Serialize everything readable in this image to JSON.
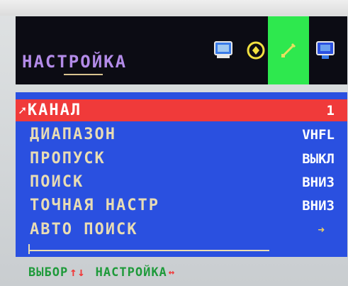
{
  "menu": {
    "title": "НАСТРОЙКА",
    "tabs": [
      {
        "name": "picture",
        "icon": "monitor-icon",
        "active": false
      },
      {
        "name": "sound",
        "icon": "speaker-clock-icon",
        "active": false
      },
      {
        "name": "setup",
        "icon": "tools-icon",
        "active": true
      },
      {
        "name": "features",
        "icon": "screen-settings-icon",
        "active": false
      }
    ],
    "items": [
      {
        "label": "КАНАЛ",
        "value": "1",
        "selected": true
      },
      {
        "label": "ДИАПАЗОН",
        "value": "VHFL",
        "selected": false
      },
      {
        "label": "ПРОПУСК",
        "value": "ВЫКЛ",
        "selected": false
      },
      {
        "label": "ПОИСК",
        "value": "ВНИЗ",
        "selected": false
      },
      {
        "label": "ТОЧНАЯ НАСТР",
        "value": "ВНИЗ",
        "selected": false
      },
      {
        "label": "АВТО ПОИСК",
        "value": "",
        "selected": false
      }
    ],
    "arrow_glyph": "➜",
    "cursor_glyph": "➚"
  },
  "footer": {
    "select_label": "ВЫБОР",
    "select_arrows": "↑↓",
    "adjust_label": "НАСТРОЙКА",
    "adjust_arrows": "↔"
  },
  "colors": {
    "header_bg": "#0c0c14",
    "title": "#b38be8",
    "active_tab": "#2ee84e",
    "body_bg": "#2a50e0",
    "selected_row": "#f03a3a",
    "label_text": "#e8dcb4",
    "footer_text": "#1e9a3a",
    "footer_arrows": "#f03a3a"
  }
}
